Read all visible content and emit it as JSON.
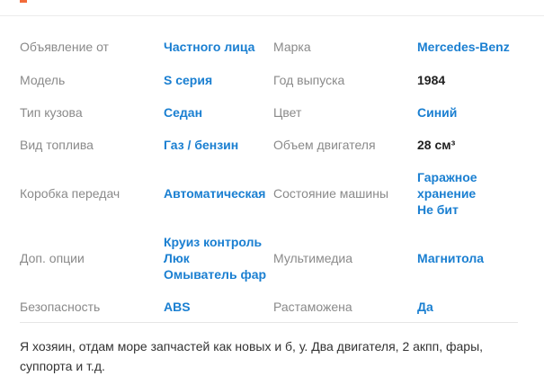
{
  "specs": {
    "rows": [
      {
        "label1": "Объявление от",
        "value1": "Частного лица",
        "label2": "Марка",
        "value2": "Mercedes-Benz"
      },
      {
        "label1": "Модель",
        "value1": "S серия",
        "label2": "Год выпуска",
        "value2": "1984"
      },
      {
        "label1": "Тип кузова",
        "value1": "Седан",
        "label2": "Цвет",
        "value2": "Синий"
      },
      {
        "label1": "Вид топлива",
        "value1": "Газ / бензин",
        "label2": "Объем двигателя",
        "value2": "28 см³"
      },
      {
        "label1": "Коробка передач",
        "value1": "Автоматическая",
        "label2": "Состояние машины",
        "value2_lines": [
          "Гаражное",
          "хранение",
          "Не бит"
        ]
      },
      {
        "label1": "Доп. опции",
        "value1_lines": [
          "Круиз контроль",
          "Люк",
          "Омыватель фар"
        ],
        "label2": "Мультимедиа",
        "value2": "Магнитола"
      },
      {
        "label1": "Безопасность",
        "value1": "ABS",
        "label2": "Растаможена",
        "value2": "Да"
      }
    ]
  },
  "description": {
    "text": "Я хозяин, отдам море запчастей как новых и б, у. Два двигателя, 2 акпп, фары, суппорта и т.д."
  }
}
